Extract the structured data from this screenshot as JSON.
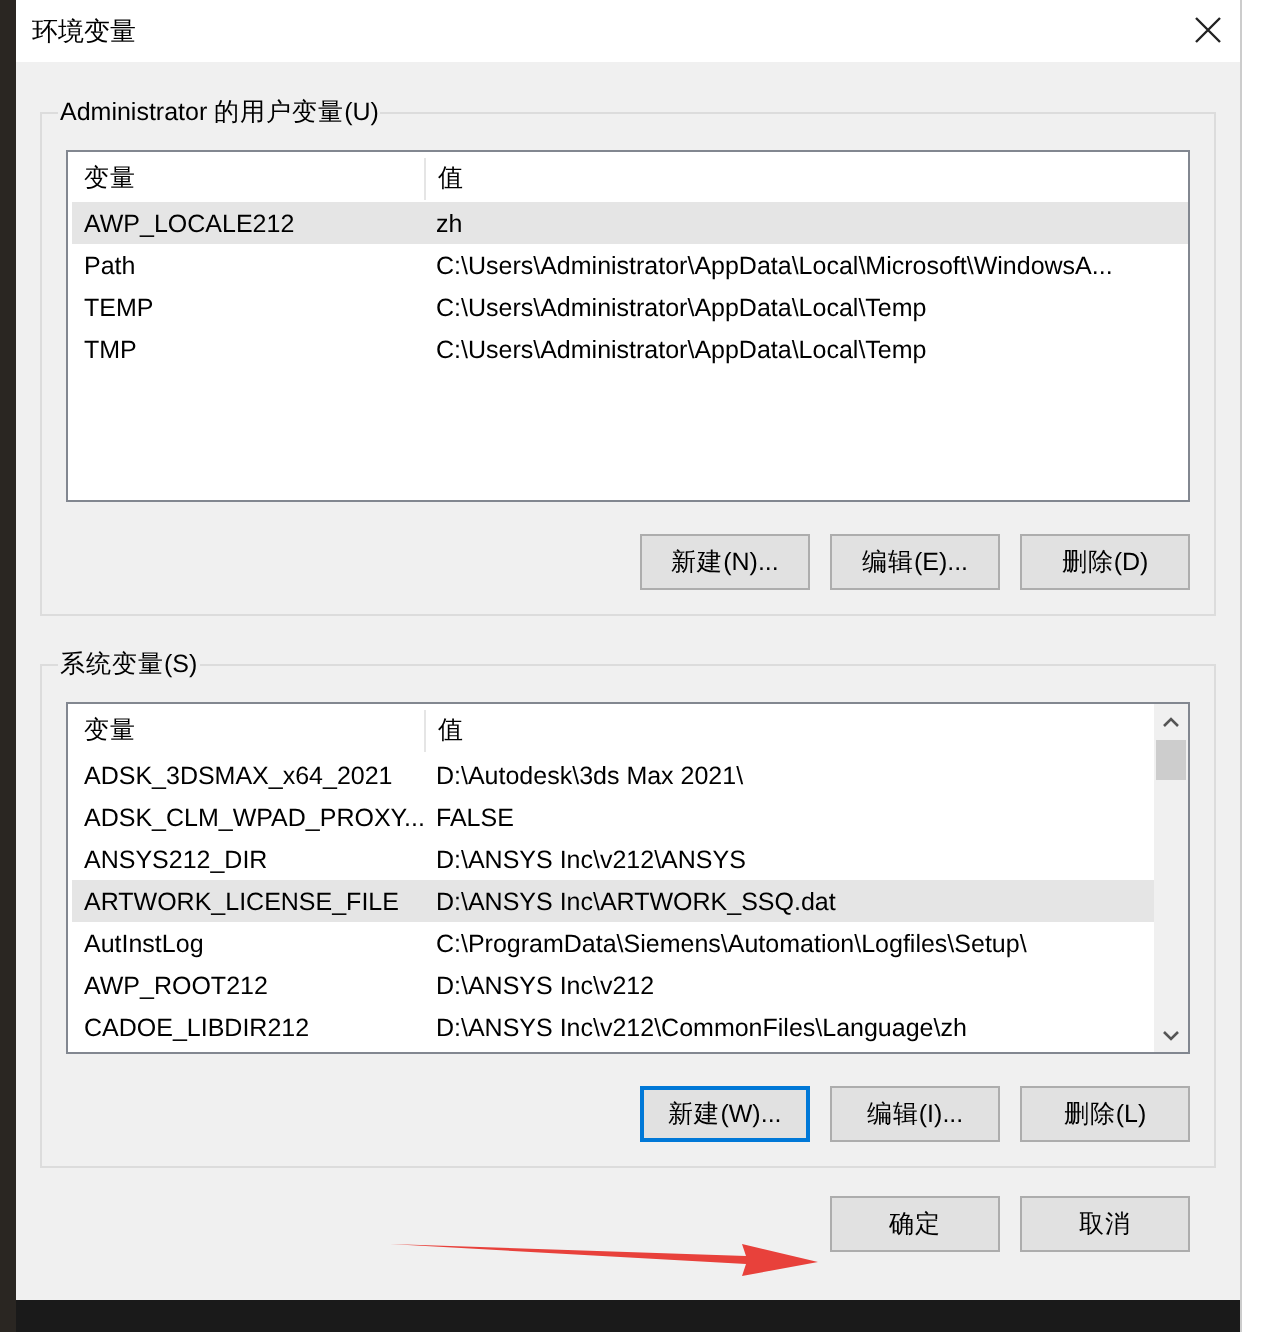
{
  "window": {
    "title": "环境变量"
  },
  "user_variables": {
    "label": "Administrator 的用户变量(U)",
    "columns": [
      "变量",
      "值"
    ],
    "rows": [
      {
        "name": "AWP_LOCALE212",
        "value": "zh",
        "selected": true
      },
      {
        "name": "Path",
        "value": "C:\\Users\\Administrator\\AppData\\Local\\Microsoft\\WindowsA...",
        "selected": false
      },
      {
        "name": "TEMP",
        "value": "C:\\Users\\Administrator\\AppData\\Local\\Temp",
        "selected": false
      },
      {
        "name": "TMP",
        "value": "C:\\Users\\Administrator\\AppData\\Local\\Temp",
        "selected": false
      }
    ],
    "buttons": [
      {
        "label": "新建(N)...",
        "focused": false
      },
      {
        "label": "编辑(E)...",
        "focused": false
      },
      {
        "label": "删除(D)",
        "focused": false
      }
    ]
  },
  "system_variables": {
    "label": "系统变量(S)",
    "columns": [
      "变量",
      "值"
    ],
    "rows": [
      {
        "name": "ADSK_3DSMAX_x64_2021",
        "value": "D:\\Autodesk\\3ds Max 2021\\",
        "selected": false
      },
      {
        "name": "ADSK_CLM_WPAD_PROXY...",
        "value": "FALSE",
        "selected": false
      },
      {
        "name": "ANSYS212_DIR",
        "value": "D:\\ANSYS Inc\\v212\\ANSYS",
        "selected": false
      },
      {
        "name": "ARTWORK_LICENSE_FILE",
        "value": "D:\\ANSYS Inc\\ARTWORK_SSQ.dat",
        "selected": true
      },
      {
        "name": "AutInstLog",
        "value": "C:\\ProgramData\\Siemens\\Automation\\Logfiles\\Setup\\",
        "selected": false
      },
      {
        "name": "AWP_ROOT212",
        "value": "D:\\ANSYS Inc\\v212",
        "selected": false
      },
      {
        "name": "CADOE_LIBDIR212",
        "value": "D:\\ANSYS Inc\\v212\\CommonFiles\\Language\\zh",
        "selected": false
      }
    ],
    "buttons": [
      {
        "label": "新建(W)...",
        "focused": true
      },
      {
        "label": "编辑(I)...",
        "focused": false
      },
      {
        "label": "删除(L)",
        "focused": false
      }
    ]
  },
  "dialog_buttons": [
    {
      "label": "确定",
      "focused": false
    },
    {
      "label": "取消",
      "focused": false
    }
  ]
}
